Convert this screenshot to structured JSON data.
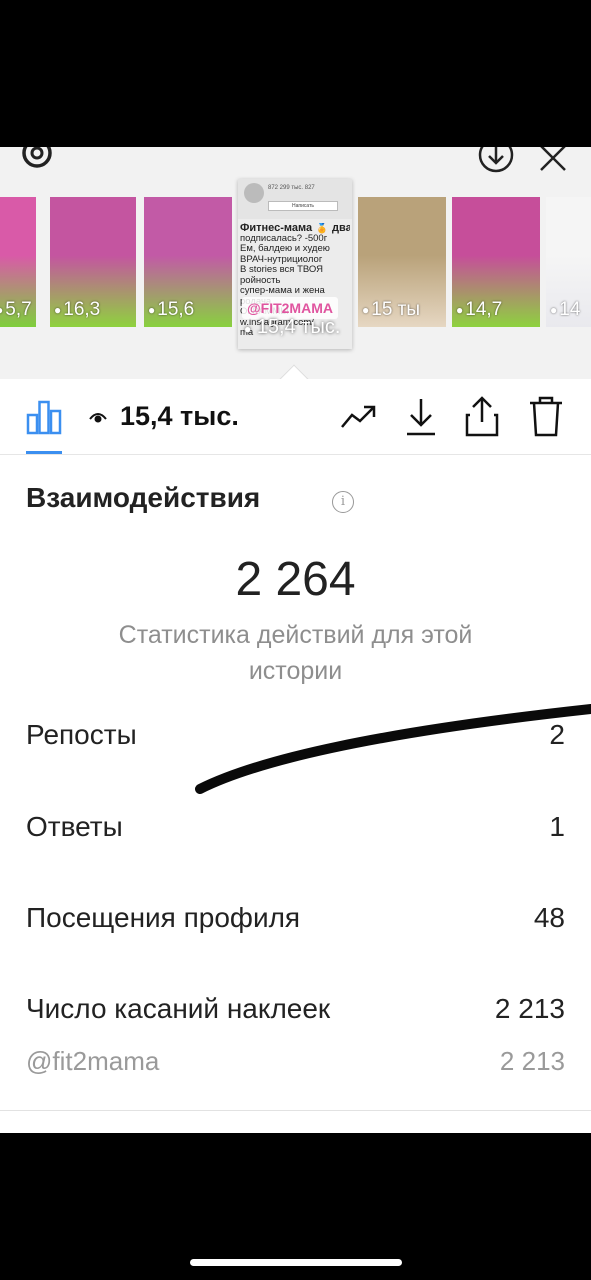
{
  "stories": [
    {
      "count": "5,7",
      "tail": "",
      "color1": "#d95aa8",
      "color2": "#7fcf3c"
    },
    {
      "count": "16,3",
      "tail": "",
      "color1": "#c455a0",
      "color2": "#8fd23e"
    },
    {
      "count": "15,6",
      "tail": "",
      "color1": "#c25aa6",
      "color2": "#89d13f"
    },
    {
      "count": "15 ты",
      "tail": "",
      "color1": "#b9a27a",
      "color2": "#e6d7c2"
    },
    {
      "count": "14,7",
      "tail": "",
      "color1": "#c64e9a",
      "color2": "#8ed23f"
    },
    {
      "count": "14",
      "tail": "",
      "color1": "#f5f5f5",
      "color2": "#e9e9ee"
    }
  ],
  "selected_story": {
    "profile_stats": "872    299 тыс.    827",
    "message_button": "Написать",
    "bio_lines": [
      "Фитнес-мама 🏅 дважды",
      "подписалась? -500г",
      "Ем, балдею и худею",
      "ВРАЧ-нутрициолог",
      "В stories вся ТВОЯ",
      "ройность",
      "супер-мама и жена",
      "родача",
      "ОГРАММЫ",
      "w.instagram.com/",
      "ma"
    ],
    "badge": "@FIT2MAMA",
    "views": "15,4 тыс."
  },
  "toolbar": {
    "views": "15,4 тыс."
  },
  "interactions": {
    "title": "Взаимодействия",
    "info_icon": "i",
    "total": "2 264",
    "caption": "Статистика действий для этой истории"
  },
  "rows": [
    {
      "label": "Репосты",
      "value": "2"
    },
    {
      "label": "Ответы",
      "value": "1"
    },
    {
      "label": "Посещения профиля",
      "value": "48"
    },
    {
      "label": "Число касаний наклеек",
      "value": "2 213"
    }
  ],
  "sub_row": {
    "label": "@fit2mama",
    "value": "2 213"
  },
  "colors": {
    "accent": "#3b8ff0",
    "text": "#222222",
    "muted": "#8e8e8e"
  }
}
